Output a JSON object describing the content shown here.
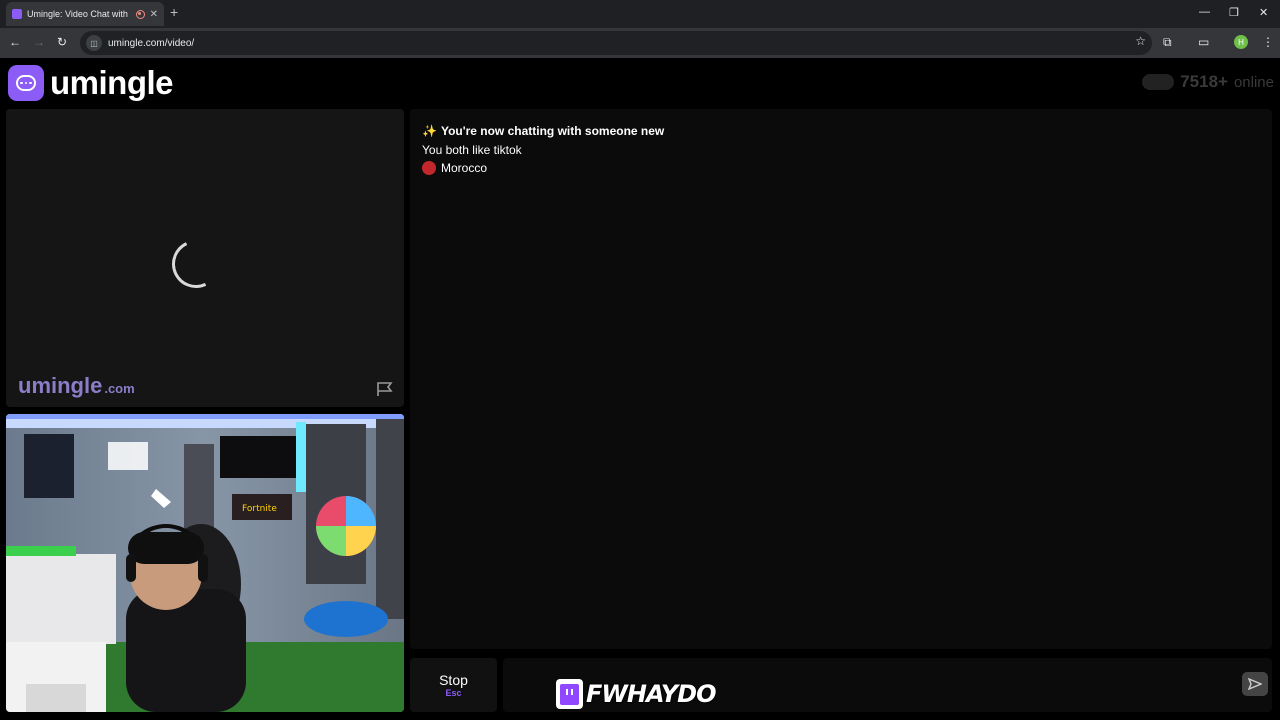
{
  "browser": {
    "tab_title": "Umingle: Video Chat with S",
    "tab_close": "✕",
    "new_tab": "+",
    "url": "umingle.com/video/",
    "profile_initial": "H",
    "controls": {
      "minimize": "—",
      "restore": "❐",
      "close": "✕"
    }
  },
  "header": {
    "logo_text": "umingle",
    "online_count": "7518+",
    "online_label": "online"
  },
  "remote_video": {
    "watermark_main": "umingle",
    "watermark_suffix": ".com"
  },
  "chat": {
    "messages": {
      "connected_icon": "✨",
      "connected": "You're now chatting with someone new",
      "interests": "You both like tiktok",
      "country": "Morocco"
    }
  },
  "controls": {
    "stop_label": "Stop",
    "stop_hint": "Esc"
  },
  "overlay": {
    "handle": "FWHAYDO"
  },
  "colors": {
    "brand": "#8b5cf6",
    "country_flag": "#c1272d",
    "background": "#000000"
  },
  "icons": [
    "umingle-logo-icon",
    "spinner-icon",
    "flag-report-icon",
    "send-icon",
    "twitch-icon",
    "sparkle-icon"
  ]
}
